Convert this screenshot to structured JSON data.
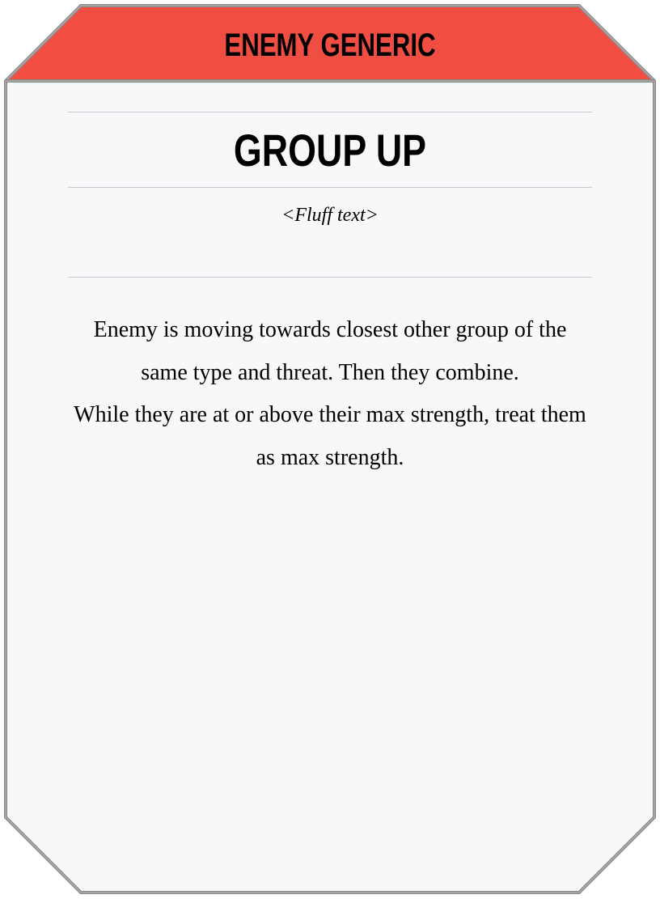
{
  "card": {
    "header": "ENEMY GENERIC",
    "title": "GROUP UP",
    "fluff": "<Fluff text>",
    "body": [
      "Enemy is moving towards closest other group of the same type and threat. Then they combine.",
      "While they are at or above their max strength, treat them as max strength."
    ]
  },
  "colors": {
    "header_bg": "#f04e42",
    "card_bg": "#f7f8fa",
    "border": "#8a8a8a"
  }
}
